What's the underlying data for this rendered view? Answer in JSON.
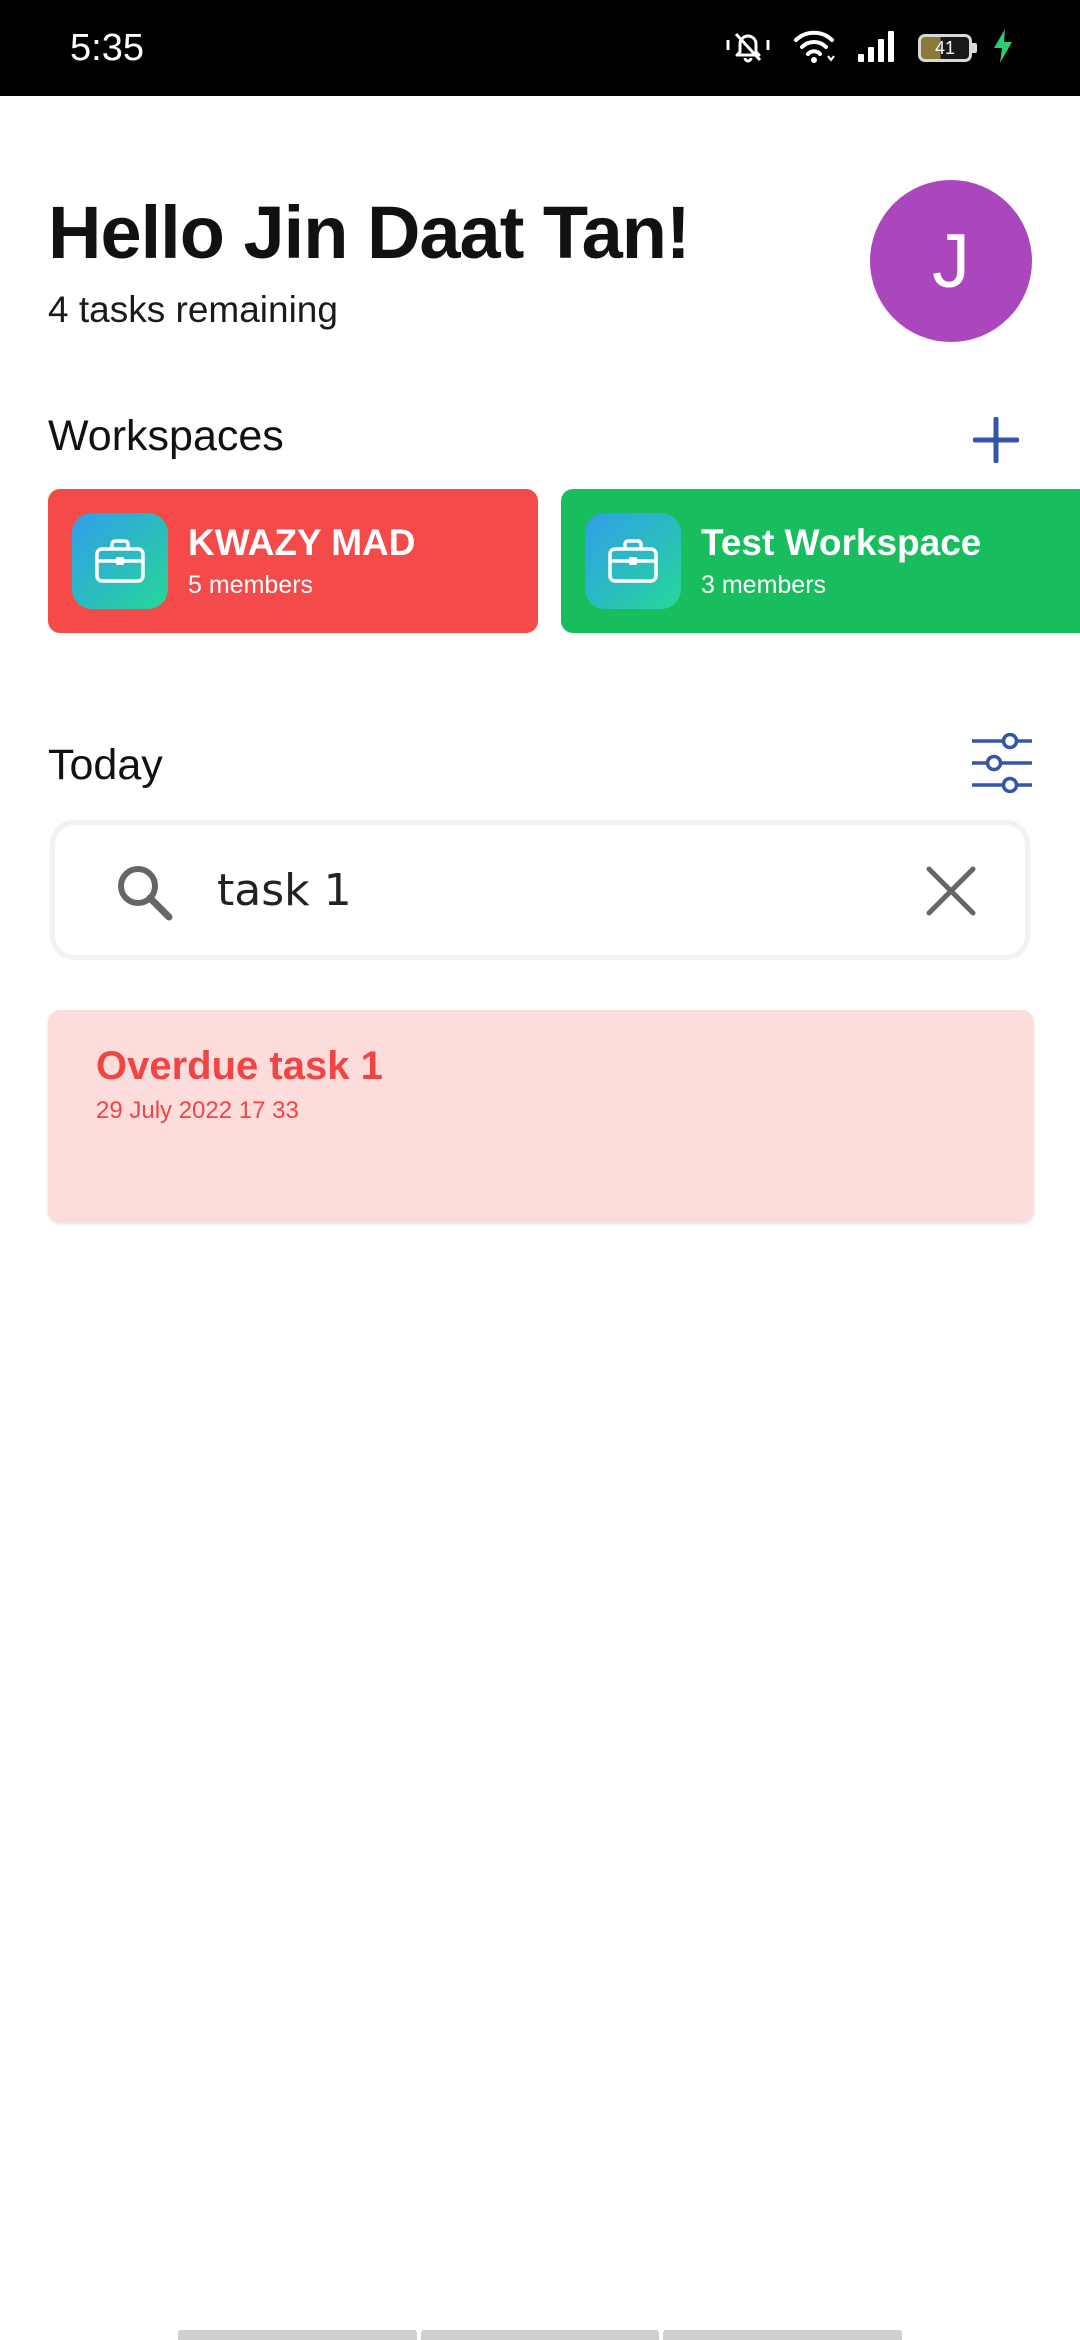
{
  "status_bar": {
    "time": "5:35",
    "battery": "41",
    "icons": [
      "silent-icon",
      "wifi-icon",
      "signal-icon",
      "battery-icon",
      "charging-icon"
    ]
  },
  "header": {
    "greeting": "Hello Jin Daat Tan!",
    "subtitle": "4 tasks remaining",
    "avatar_initial": "J",
    "avatar_color": "#ab47bc"
  },
  "workspaces": {
    "title": "Workspaces",
    "add_icon": "plus-icon",
    "items": [
      {
        "name": "KWAZY MAD",
        "members": "5 members",
        "color": "#f44a4a",
        "icon": "briefcase-icon"
      },
      {
        "name": "Test Workspace",
        "members": "3 members",
        "color": "#18bd5e",
        "icon": "briefcase-icon"
      }
    ]
  },
  "today": {
    "title": "Today",
    "filter_icon": "sliders-icon"
  },
  "search": {
    "value": "task 1",
    "search_icon": "search-icon",
    "clear_icon": "close-icon"
  },
  "tasks": [
    {
      "title": "Overdue task 1",
      "date": "29 July 2022 17 33",
      "status_color": "#f04545",
      "background": "#fddcdc"
    }
  ],
  "colors": {
    "accent": "#3355aa"
  }
}
